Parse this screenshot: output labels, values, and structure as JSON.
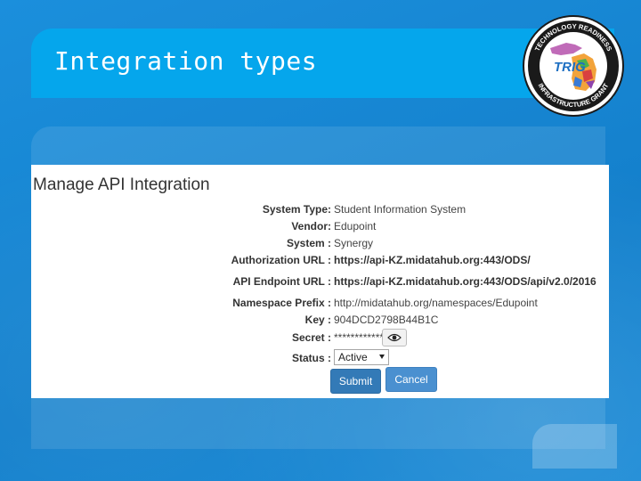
{
  "slide": {
    "title": "Integration types",
    "logo": {
      "label": "TRIG",
      "ring_top_text": "TECHNOLOGY READINESS",
      "ring_bottom_text": "INFRASTRUCTURE GRANT"
    }
  },
  "form": {
    "heading": "Manage API Integration",
    "fields": [
      {
        "label": "System Type:",
        "value": "Student Information System"
      },
      {
        "label": "Vendor:",
        "value": "Edupoint"
      },
      {
        "label": "System :",
        "value": "Synergy"
      },
      {
        "label": "Authorization URL :",
        "value": "https://api-KZ.midatahub.org:443/ODS/"
      },
      {
        "label": "API Endpoint URL :",
        "value": "https://api-KZ.midatahub.org:443/ODS/api/v2.0/2016"
      },
      {
        "label": "Namespace Prefix :",
        "value": "http://midatahub.org/namespaces/Edupoint"
      },
      {
        "label": "Key :",
        "value": "904DCD2798B44B1C"
      },
      {
        "label": "Secret :",
        "value": "************"
      },
      {
        "label": "Status :",
        "value": "Active"
      }
    ],
    "submit_label": "Submit",
    "cancel_label": "Cancel"
  },
  "icons": {
    "reveal_secret": "eye-icon"
  },
  "colors": {
    "background": "#1587d4",
    "title_band": "#05a6ec",
    "submit": "#337ab7",
    "cancel": "#4a90d0"
  }
}
